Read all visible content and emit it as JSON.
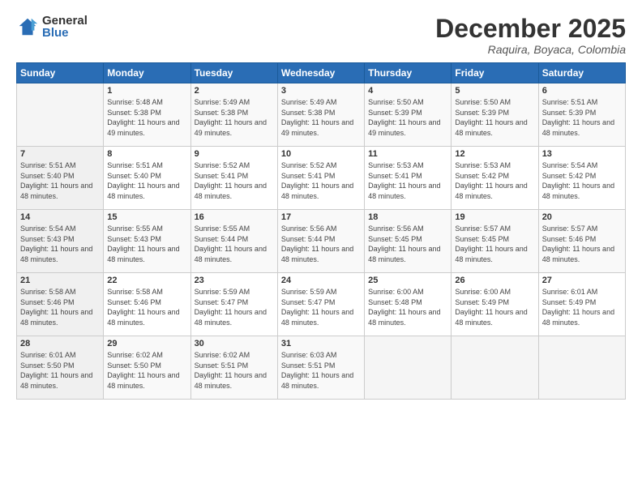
{
  "logo": {
    "general": "General",
    "blue": "Blue"
  },
  "title": "December 2025",
  "location": "Raquira, Boyaca, Colombia",
  "days_of_week": [
    "Sunday",
    "Monday",
    "Tuesday",
    "Wednesday",
    "Thursday",
    "Friday",
    "Saturday"
  ],
  "weeks": [
    [
      {
        "day": "",
        "sunrise": "",
        "sunset": "",
        "daylight": ""
      },
      {
        "day": "1",
        "sunrise": "Sunrise: 5:48 AM",
        "sunset": "Sunset: 5:38 PM",
        "daylight": "Daylight: 11 hours and 49 minutes."
      },
      {
        "day": "2",
        "sunrise": "Sunrise: 5:49 AM",
        "sunset": "Sunset: 5:38 PM",
        "daylight": "Daylight: 11 hours and 49 minutes."
      },
      {
        "day": "3",
        "sunrise": "Sunrise: 5:49 AM",
        "sunset": "Sunset: 5:38 PM",
        "daylight": "Daylight: 11 hours and 49 minutes."
      },
      {
        "day": "4",
        "sunrise": "Sunrise: 5:50 AM",
        "sunset": "Sunset: 5:39 PM",
        "daylight": "Daylight: 11 hours and 49 minutes."
      },
      {
        "day": "5",
        "sunrise": "Sunrise: 5:50 AM",
        "sunset": "Sunset: 5:39 PM",
        "daylight": "Daylight: 11 hours and 48 minutes."
      },
      {
        "day": "6",
        "sunrise": "Sunrise: 5:51 AM",
        "sunset": "Sunset: 5:39 PM",
        "daylight": "Daylight: 11 hours and 48 minutes."
      }
    ],
    [
      {
        "day": "7",
        "sunrise": "Sunrise: 5:51 AM",
        "sunset": "Sunset: 5:40 PM",
        "daylight": "Daylight: 11 hours and 48 minutes."
      },
      {
        "day": "8",
        "sunrise": "Sunrise: 5:51 AM",
        "sunset": "Sunset: 5:40 PM",
        "daylight": "Daylight: 11 hours and 48 minutes."
      },
      {
        "day": "9",
        "sunrise": "Sunrise: 5:52 AM",
        "sunset": "Sunset: 5:41 PM",
        "daylight": "Daylight: 11 hours and 48 minutes."
      },
      {
        "day": "10",
        "sunrise": "Sunrise: 5:52 AM",
        "sunset": "Sunset: 5:41 PM",
        "daylight": "Daylight: 11 hours and 48 minutes."
      },
      {
        "day": "11",
        "sunrise": "Sunrise: 5:53 AM",
        "sunset": "Sunset: 5:41 PM",
        "daylight": "Daylight: 11 hours and 48 minutes."
      },
      {
        "day": "12",
        "sunrise": "Sunrise: 5:53 AM",
        "sunset": "Sunset: 5:42 PM",
        "daylight": "Daylight: 11 hours and 48 minutes."
      },
      {
        "day": "13",
        "sunrise": "Sunrise: 5:54 AM",
        "sunset": "Sunset: 5:42 PM",
        "daylight": "Daylight: 11 hours and 48 minutes."
      }
    ],
    [
      {
        "day": "14",
        "sunrise": "Sunrise: 5:54 AM",
        "sunset": "Sunset: 5:43 PM",
        "daylight": "Daylight: 11 hours and 48 minutes."
      },
      {
        "day": "15",
        "sunrise": "Sunrise: 5:55 AM",
        "sunset": "Sunset: 5:43 PM",
        "daylight": "Daylight: 11 hours and 48 minutes."
      },
      {
        "day": "16",
        "sunrise": "Sunrise: 5:55 AM",
        "sunset": "Sunset: 5:44 PM",
        "daylight": "Daylight: 11 hours and 48 minutes."
      },
      {
        "day": "17",
        "sunrise": "Sunrise: 5:56 AM",
        "sunset": "Sunset: 5:44 PM",
        "daylight": "Daylight: 11 hours and 48 minutes."
      },
      {
        "day": "18",
        "sunrise": "Sunrise: 5:56 AM",
        "sunset": "Sunset: 5:45 PM",
        "daylight": "Daylight: 11 hours and 48 minutes."
      },
      {
        "day": "19",
        "sunrise": "Sunrise: 5:57 AM",
        "sunset": "Sunset: 5:45 PM",
        "daylight": "Daylight: 11 hours and 48 minutes."
      },
      {
        "day": "20",
        "sunrise": "Sunrise: 5:57 AM",
        "sunset": "Sunset: 5:46 PM",
        "daylight": "Daylight: 11 hours and 48 minutes."
      }
    ],
    [
      {
        "day": "21",
        "sunrise": "Sunrise: 5:58 AM",
        "sunset": "Sunset: 5:46 PM",
        "daylight": "Daylight: 11 hours and 48 minutes."
      },
      {
        "day": "22",
        "sunrise": "Sunrise: 5:58 AM",
        "sunset": "Sunset: 5:46 PM",
        "daylight": "Daylight: 11 hours and 48 minutes."
      },
      {
        "day": "23",
        "sunrise": "Sunrise: 5:59 AM",
        "sunset": "Sunset: 5:47 PM",
        "daylight": "Daylight: 11 hours and 48 minutes."
      },
      {
        "day": "24",
        "sunrise": "Sunrise: 5:59 AM",
        "sunset": "Sunset: 5:47 PM",
        "daylight": "Daylight: 11 hours and 48 minutes."
      },
      {
        "day": "25",
        "sunrise": "Sunrise: 6:00 AM",
        "sunset": "Sunset: 5:48 PM",
        "daylight": "Daylight: 11 hours and 48 minutes."
      },
      {
        "day": "26",
        "sunrise": "Sunrise: 6:00 AM",
        "sunset": "Sunset: 5:49 PM",
        "daylight": "Daylight: 11 hours and 48 minutes."
      },
      {
        "day": "27",
        "sunrise": "Sunrise: 6:01 AM",
        "sunset": "Sunset: 5:49 PM",
        "daylight": "Daylight: 11 hours and 48 minutes."
      }
    ],
    [
      {
        "day": "28",
        "sunrise": "Sunrise: 6:01 AM",
        "sunset": "Sunset: 5:50 PM",
        "daylight": "Daylight: 11 hours and 48 minutes."
      },
      {
        "day": "29",
        "sunrise": "Sunrise: 6:02 AM",
        "sunset": "Sunset: 5:50 PM",
        "daylight": "Daylight: 11 hours and 48 minutes."
      },
      {
        "day": "30",
        "sunrise": "Sunrise: 6:02 AM",
        "sunset": "Sunset: 5:51 PM",
        "daylight": "Daylight: 11 hours and 48 minutes."
      },
      {
        "day": "31",
        "sunrise": "Sunrise: 6:03 AM",
        "sunset": "Sunset: 5:51 PM",
        "daylight": "Daylight: 11 hours and 48 minutes."
      },
      {
        "day": "",
        "sunrise": "",
        "sunset": "",
        "daylight": ""
      },
      {
        "day": "",
        "sunrise": "",
        "sunset": "",
        "daylight": ""
      },
      {
        "day": "",
        "sunrise": "",
        "sunset": "",
        "daylight": ""
      }
    ]
  ]
}
